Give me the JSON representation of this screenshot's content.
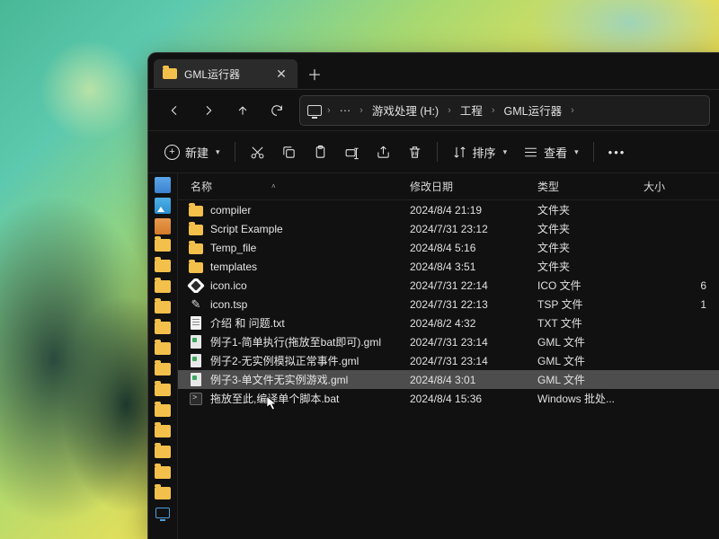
{
  "tab": {
    "title": "GML运行器"
  },
  "breadcrumbs": {
    "more": "···",
    "drive": "游戏处理 (H:)",
    "folder1": "工程",
    "folder2": "GML运行器"
  },
  "toolbar": {
    "new": "新建",
    "sort": "排序",
    "view": "查看"
  },
  "columns": {
    "name": "名称",
    "date": "修改日期",
    "type": "类型",
    "size": "大小"
  },
  "quick_bar": [
    {
      "kind": "doc"
    },
    {
      "kind": "img"
    },
    {
      "kind": "music"
    },
    {
      "kind": "folder"
    },
    {
      "kind": "folder"
    },
    {
      "kind": "folder"
    },
    {
      "kind": "folder"
    },
    {
      "kind": "folder"
    },
    {
      "kind": "folder"
    },
    {
      "kind": "folder"
    },
    {
      "kind": "folder"
    },
    {
      "kind": "folder"
    },
    {
      "kind": "folder"
    },
    {
      "kind": "folder"
    },
    {
      "kind": "folder"
    },
    {
      "kind": "folder"
    },
    {
      "kind": "monitor"
    }
  ],
  "files": [
    {
      "icon": "folder",
      "name": "compiler",
      "date": "2024/8/4 21:19",
      "type": "文件夹",
      "size": "",
      "sel": false
    },
    {
      "icon": "folder",
      "name": "Script Example",
      "date": "2024/7/31 23:12",
      "type": "文件夹",
      "size": "",
      "sel": false
    },
    {
      "icon": "folder",
      "name": "Temp_file",
      "date": "2024/8/4 5:16",
      "type": "文件夹",
      "size": "",
      "sel": false
    },
    {
      "icon": "folder",
      "name": "templates",
      "date": "2024/8/4 3:51",
      "type": "文件夹",
      "size": "",
      "sel": false
    },
    {
      "icon": "ico",
      "name": "icon.ico",
      "date": "2024/7/31 22:14",
      "type": "ICO 文件",
      "size": "6",
      "sel": false
    },
    {
      "icon": "tsp",
      "name": "icon.tsp",
      "date": "2024/7/31 22:13",
      "type": "TSP 文件",
      "size": "1",
      "sel": false
    },
    {
      "icon": "txt",
      "name": "介绍 和 问题.txt",
      "date": "2024/8/2 4:32",
      "type": "TXT 文件",
      "size": "",
      "sel": false
    },
    {
      "icon": "gml",
      "name": "例子1-简单执行(拖放至bat即可).gml",
      "date": "2024/7/31 23:14",
      "type": "GML 文件",
      "size": "",
      "sel": false
    },
    {
      "icon": "gml",
      "name": "例子2-无实例模拟正常事件.gml",
      "date": "2024/7/31 23:14",
      "type": "GML 文件",
      "size": "",
      "sel": false
    },
    {
      "icon": "gml",
      "name": "例子3-单文件无实例游戏.gml",
      "date": "2024/8/4 3:01",
      "type": "GML 文件",
      "size": "",
      "sel": true
    },
    {
      "icon": "bat",
      "name": "拖放至此,编译单个脚本.bat",
      "date": "2024/8/4 15:36",
      "type": "Windows 批处...",
      "size": "",
      "sel": false
    }
  ]
}
